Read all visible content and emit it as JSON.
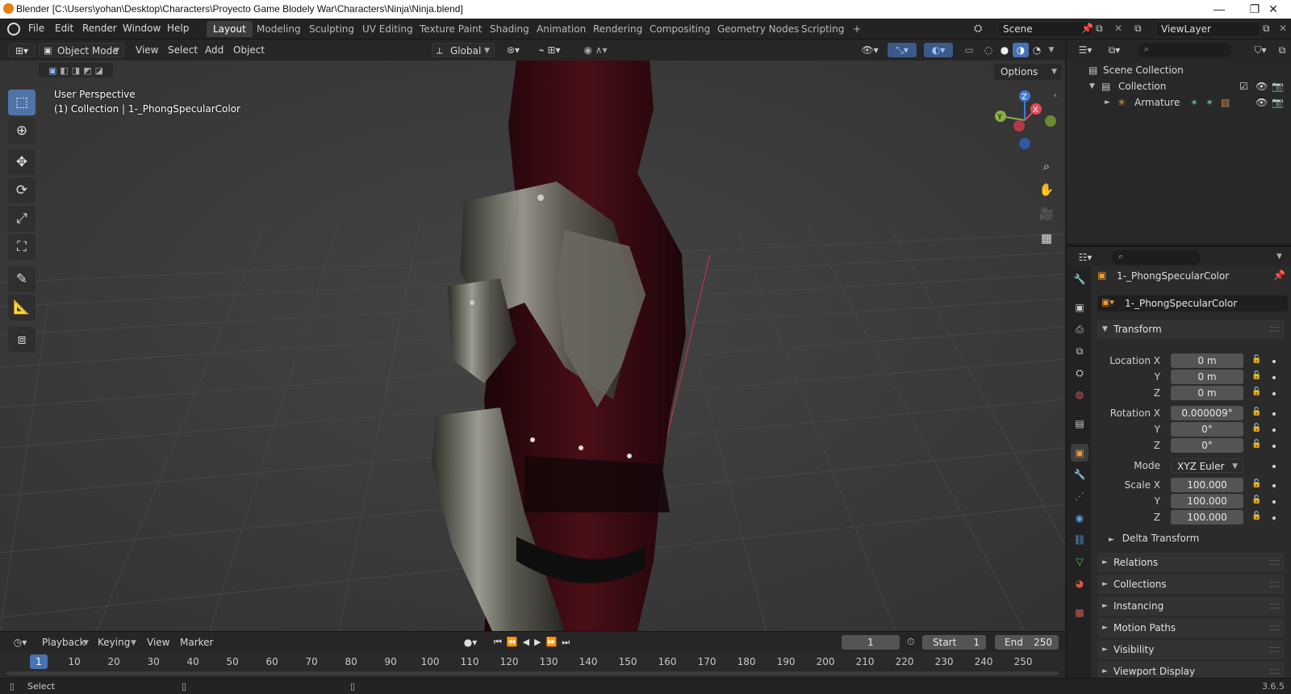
{
  "window": {
    "title": "Blender [C:\\Users\\yohan\\Desktop\\Characters\\Proyecto Game Blodely War\\Characters\\Ninja\\Ninja.blend]",
    "minimize": "—",
    "maximize": "❐",
    "close": "✕"
  },
  "menu": [
    "File",
    "Edit",
    "Render",
    "Window",
    "Help"
  ],
  "workspace_tabs": [
    "Layout",
    "Modeling",
    "Sculpting",
    "UV Editing",
    "Texture Paint",
    "Shading",
    "Animation",
    "Rendering",
    "Compositing",
    "Geometry Nodes",
    "Scripting",
    "+"
  ],
  "active_tab": "Layout",
  "scene": {
    "label": "Scene",
    "viewlayer": "ViewLayer"
  },
  "viewport_header": {
    "mode": "Object Mode",
    "menus": [
      "View",
      "Select",
      "Add",
      "Object"
    ],
    "orientation": "Global",
    "options": "Options"
  },
  "viewport": {
    "perspective": "User Perspective",
    "collection_info": "(1) Collection | 1-_PhongSpecularColor",
    "gizmo": {
      "x": "X",
      "y": "Y",
      "z": "Z"
    }
  },
  "tools": [
    "select-box",
    "cursor",
    "move",
    "rotate",
    "scale",
    "transform",
    "annotate",
    "measure",
    "add-cube"
  ],
  "timeline": {
    "menus": [
      "Playback",
      "Keying",
      "View",
      "Marker"
    ],
    "current_frame": "1",
    "start_label": "Start",
    "start": "1",
    "end_label": "End",
    "end": "250",
    "ruler": [
      "1",
      "10",
      "20",
      "30",
      "40",
      "50",
      "60",
      "70",
      "80",
      "90",
      "100",
      "110",
      "120",
      "130",
      "140",
      "150",
      "160",
      "170",
      "180",
      "190",
      "200",
      "210",
      "220",
      "230",
      "240",
      "250"
    ]
  },
  "outliner": {
    "scene_collection": "Scene Collection",
    "collection": "Collection",
    "armature": "Armature"
  },
  "properties": {
    "object_name": "1-_PhongSpecularColor",
    "object_field": "1-_PhongSpecularColor",
    "transform_label": "Transform",
    "location_label": "Location X",
    "rotation_label": "Rotation X",
    "scale_label": "Scale X",
    "y_label": "Y",
    "z_label": "Z",
    "mode_label": "Mode",
    "location": [
      "0 m",
      "0 m",
      "0 m"
    ],
    "rotation": [
      "0.000009°",
      "0°",
      "0°"
    ],
    "mode": "XYZ Euler",
    "scale": [
      "100.000",
      "100.000",
      "100.000"
    ],
    "delta_transform": "Delta Transform",
    "panels": [
      "Relations",
      "Collections",
      "Instancing",
      "Motion Paths",
      "Visibility",
      "Viewport Display"
    ]
  },
  "status": {
    "left": "Select",
    "version": "3.6.5"
  },
  "colors": {
    "accent": "#5073a8",
    "x_axis": "#e04b5a",
    "y_axis": "#8ab040",
    "z_axis": "#3f7ad6",
    "timeline_frame": "#4772b3"
  }
}
